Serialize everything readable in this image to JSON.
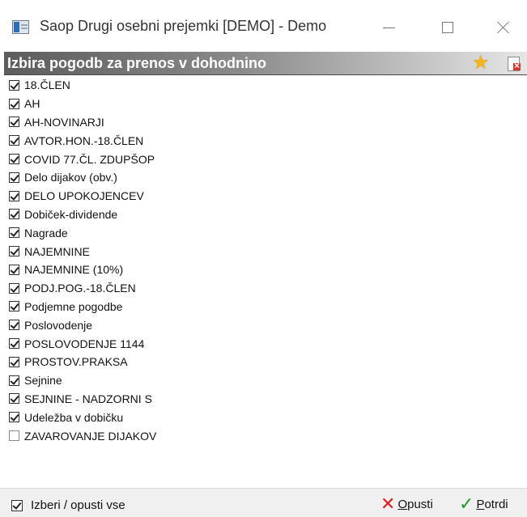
{
  "window": {
    "title": "Saop Drugi osebni prejemki  [DEMO] - Demo"
  },
  "header": {
    "title": "Izbira pogodb za prenos v dohodnino"
  },
  "items": [
    {
      "label": "18.ČLEN",
      "checked": true
    },
    {
      "label": "AH",
      "checked": true
    },
    {
      "label": "AH-NOVINARJI",
      "checked": true
    },
    {
      "label": "AVTOR.HON.-18.ČLEN",
      "checked": true
    },
    {
      "label": "COVID 77.ČL. ZDUPŠOP",
      "checked": true
    },
    {
      "label": "Delo dijakov (obv.)",
      "checked": true
    },
    {
      "label": "DELO UPOKOJENCEV",
      "checked": true
    },
    {
      "label": "Dobiček-dividende",
      "checked": true
    },
    {
      "label": "Nagrade",
      "checked": true
    },
    {
      "label": "NAJEMNINE",
      "checked": true
    },
    {
      "label": "NAJEMNINE (10%)",
      "checked": true
    },
    {
      "label": "PODJ.POG.-18.ČLEN",
      "checked": true
    },
    {
      "label": "Podjemne pogodbe",
      "checked": true
    },
    {
      "label": "Poslovodenje",
      "checked": true
    },
    {
      "label": "POSLOVODENJE 1144",
      "checked": true
    },
    {
      "label": "PROSTOV.PRAKSA",
      "checked": true
    },
    {
      "label": "Sejnine",
      "checked": true
    },
    {
      "label": "SEJNINE - NADZORNI S",
      "checked": true
    },
    {
      "label": "Udeležba v dobičku",
      "checked": true
    },
    {
      "label": "ZAVAROVANJE DIJAKOV",
      "checked": false
    }
  ],
  "footer": {
    "select_all_label": "Izberi / opusti vse",
    "select_all_checked": true,
    "cancel_first": "O",
    "cancel_rest": "pusti",
    "confirm_first": "P",
    "confirm_rest": "otrdi"
  },
  "colors": {
    "cancel_icon": "#d62020",
    "confirm_icon": "#1e9a2a",
    "favorite_icon": "#f2b51d"
  }
}
